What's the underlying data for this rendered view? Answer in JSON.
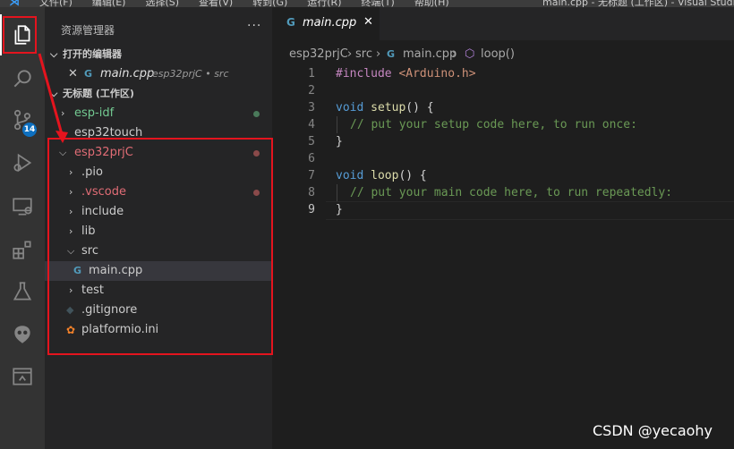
{
  "menubar": {
    "items": [
      "文件(F)",
      "编辑(E)",
      "选择(S)",
      "查看(V)",
      "转到(G)",
      "运行(R)",
      "终端(T)",
      "帮助(H)"
    ],
    "window_title": "main.cpp - 无标题 (工作区) - Visual Studio"
  },
  "activity_bar": {
    "badge": "14"
  },
  "sidebar": {
    "title": "资源管理器",
    "more": "···",
    "open_editors": {
      "label": "打开的编辑器",
      "file": "main.cpp",
      "desc": "esp32prjC • src"
    },
    "workspace": {
      "label": "无标题 (工作区)",
      "folders": [
        {
          "label": "esp-idf",
          "color": "#73c991"
        },
        {
          "label": "esp32touch",
          "color": "#cccccc"
        },
        {
          "label": "esp32prjC",
          "color": "#e06c75"
        }
      ],
      "children": [
        {
          "label": ".pio"
        },
        {
          "label": ".vscode"
        },
        {
          "label": "include"
        },
        {
          "label": "lib"
        },
        {
          "label": "src"
        },
        {
          "label": "main.cpp"
        },
        {
          "label": "test"
        },
        {
          "label": ".gitignore"
        },
        {
          "label": "platformio.ini"
        }
      ]
    }
  },
  "editor": {
    "tab_label": "main.cpp",
    "breadcrumbs": [
      "esp32prjC",
      "src",
      "main.cpp",
      "loop()"
    ],
    "line_numbers": [
      "1",
      "2",
      "3",
      "4",
      "5",
      "6",
      "7",
      "8",
      "9"
    ],
    "current_line": "9"
  },
  "code": {
    "l1_include": "#include",
    "l1_header": "<Arduino.h>",
    "l3_type": "void",
    "l3_fn": "setup",
    "l3_rest": "() {",
    "l4_comment": "// put your setup code here, to run once:",
    "l5": "}",
    "l7_type": "void",
    "l7_fn": "loop",
    "l7_rest": "() {",
    "l8_comment": "// put your main code here, to run repeatedly:",
    "l9": "}"
  },
  "watermark": "CSDN @yecaohy",
  "colors": {
    "annotation_red": "#e4141e",
    "accent_blue": "#0e70c0",
    "modified_dot": "#8a4a4a",
    "git_green": "#73c991"
  }
}
